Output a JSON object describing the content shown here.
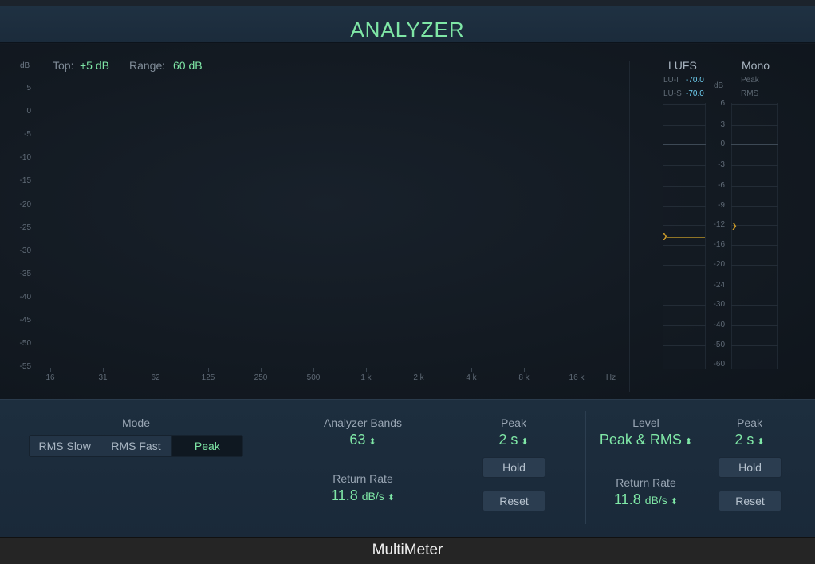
{
  "window": {
    "title": "ANALYZER",
    "footer": "MultiMeter"
  },
  "analyzer": {
    "unit_label": "dB",
    "top_label": "Top:",
    "top_value": "+5 dB",
    "range_label": "Range:",
    "range_value": "60 dB",
    "db_scale": [
      "5",
      "0",
      "-5",
      "-10",
      "-15",
      "-20",
      "-25",
      "-30",
      "-35",
      "-40",
      "-45",
      "-50",
      "-55"
    ],
    "freq_scale": [
      "16",
      "31",
      "62",
      "125",
      "250",
      "500",
      "1 k",
      "2 k",
      "4 k",
      "8 k",
      "16 k",
      "Hz"
    ]
  },
  "meters": {
    "lufs_title": "LUFS",
    "mono_title": "Mono",
    "lu_i_label": "LU-I",
    "lu_i_value": "-70.0",
    "lu_s_label": "LU-S",
    "lu_s_value": "-70.0",
    "db_label": "dB",
    "peak_label": "Peak",
    "rms_label": "RMS",
    "db_scale": [
      "6",
      "3",
      "0",
      "-3",
      "-6",
      "-9",
      "-12",
      "-16",
      "-20",
      "-24",
      "-30",
      "-40",
      "-50",
      "-60"
    ],
    "lufs_marker": "-12.5",
    "mono_marker": "-12"
  },
  "controls": {
    "mode": {
      "label": "Mode",
      "options": [
        "RMS Slow",
        "RMS Fast",
        "Peak"
      ],
      "selected": "Peak"
    },
    "analyzer_bands": {
      "label": "Analyzer Bands",
      "value": "63"
    },
    "analyzer_peak": {
      "label": "Peak",
      "value": "2 s",
      "hold": "Hold",
      "reset": "Reset"
    },
    "analyzer_return_rate": {
      "label": "Return Rate",
      "value": "11.8",
      "unit": "dB/s"
    },
    "level": {
      "label": "Level",
      "value": "Peak & RMS"
    },
    "level_peak": {
      "label": "Peak",
      "value": "2 s",
      "hold": "Hold",
      "reset": "Reset"
    },
    "level_return_rate": {
      "label": "Return Rate",
      "value": "11.8",
      "unit": "dB/s"
    }
  },
  "colors": {
    "accent": "#7fe7a6",
    "lufs_value": "#6fd0f2",
    "marker": "#c7982a"
  }
}
